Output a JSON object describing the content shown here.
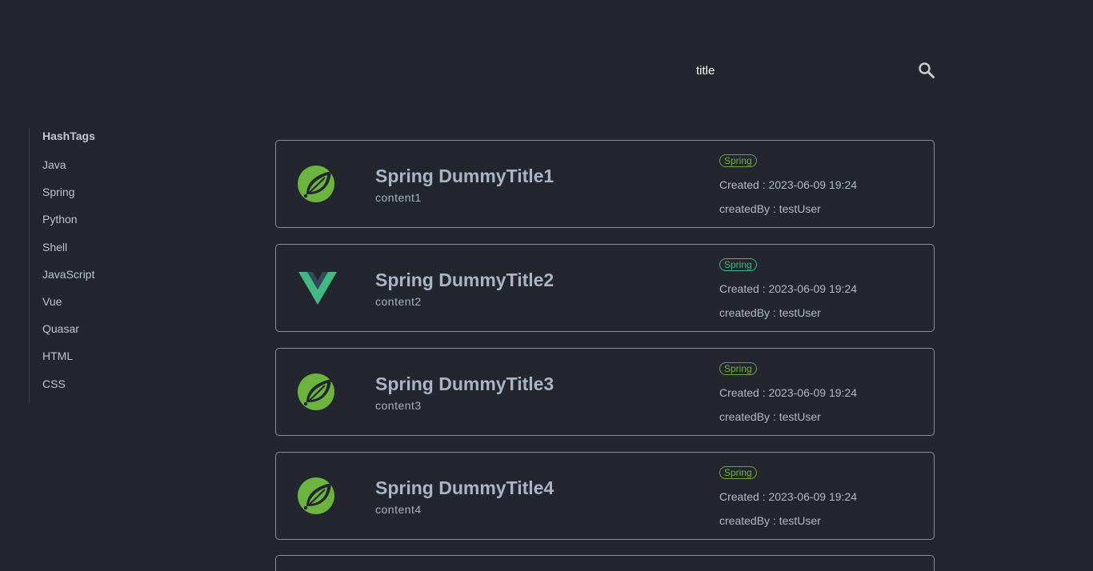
{
  "search": {
    "value": "title",
    "icon": "search-icon"
  },
  "sidebar": {
    "title": "HashTags",
    "items": [
      {
        "label": "Java"
      },
      {
        "label": "Spring"
      },
      {
        "label": "Python"
      },
      {
        "label": "Shell"
      },
      {
        "label": "JavaScript"
      },
      {
        "label": "Vue"
      },
      {
        "label": "Quasar"
      },
      {
        "label": "HTML"
      },
      {
        "label": "CSS"
      }
    ]
  },
  "posts": [
    {
      "logo": "spring-logo",
      "title": "Spring DummyTitle1",
      "content": "content1",
      "tag": "Spring",
      "created": "Created : 2023-06-09 19:24",
      "created_by": "createdBy : testUser"
    },
    {
      "logo": "vue-logo",
      "title": "Spring DummyTitle2",
      "content": "content2",
      "tag": "Spring",
      "created": "Created : 2023-06-09 19:24",
      "created_by": "createdBy : testUser"
    },
    {
      "logo": "spring-logo",
      "title": "Spring DummyTitle3",
      "content": "content3",
      "tag": "Spring",
      "created": "Created : 2023-06-09 19:24",
      "created_by": "createdBy : testUser"
    },
    {
      "logo": "spring-logo",
      "title": "Spring DummyTitle4",
      "content": "content4",
      "tag": "Spring",
      "created": "Created : 2023-06-09 19:24",
      "created_by": "createdBy : testUser"
    }
  ],
  "colors": {
    "background": "#23262e",
    "spring_green": "#6db33f",
    "vue_green": "#42b883",
    "vue_dark": "#35495e",
    "title": "#a9b4c6"
  }
}
